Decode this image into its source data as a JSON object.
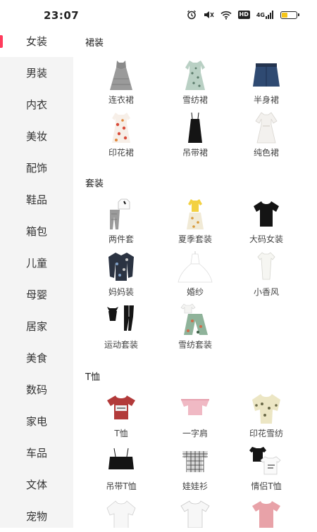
{
  "status_bar": {
    "time": "23:07",
    "network": "4G",
    "hd": "HD",
    "battery_level": 0.4
  },
  "sidebar": {
    "items": [
      {
        "label": "女装",
        "active": true
      },
      {
        "label": "男装"
      },
      {
        "label": "内衣"
      },
      {
        "label": "美妆"
      },
      {
        "label": "配饰"
      },
      {
        "label": "鞋品"
      },
      {
        "label": "箱包"
      },
      {
        "label": "儿童"
      },
      {
        "label": "母婴"
      },
      {
        "label": "居家"
      },
      {
        "label": "美食"
      },
      {
        "label": "数码"
      },
      {
        "label": "家电"
      },
      {
        "label": "车品"
      },
      {
        "label": "文体"
      },
      {
        "label": "宠物"
      }
    ]
  },
  "sections": [
    {
      "title": "裙装",
      "items": [
        {
          "label": "连衣裙",
          "icon": "gray-dress-icon"
        },
        {
          "label": "雪纺裙",
          "icon": "floral-chiffon-dress-icon"
        },
        {
          "label": "半身裙",
          "icon": "denim-skirt-icon"
        },
        {
          "label": "印花裙",
          "icon": "print-dress-icon"
        },
        {
          "label": "吊带裙",
          "icon": "slip-dress-icon"
        },
        {
          "label": "纯色裙",
          "icon": "white-dress-icon"
        }
      ]
    },
    {
      "title": "套装",
      "items": [
        {
          "label": "两件套",
          "icon": "two-piece-set-icon"
        },
        {
          "label": "夏季套装",
          "icon": "summer-set-icon"
        },
        {
          "label": "大码女装",
          "icon": "black-tshirt-icon"
        },
        {
          "label": "妈妈装",
          "icon": "printed-jacket-icon"
        },
        {
          "label": "婚纱",
          "icon": "wedding-dress-icon"
        },
        {
          "label": "小香风",
          "icon": "white-top-icon"
        },
        {
          "label": "运动套装",
          "icon": "sport-set-icon"
        },
        {
          "label": "雪纺套装",
          "icon": "chiffon-set-icon"
        }
      ]
    },
    {
      "title": "T恤",
      "items": [
        {
          "label": "T恤",
          "icon": "red-tshirt-icon"
        },
        {
          "label": "一字肩",
          "icon": "off-shoulder-top-icon"
        },
        {
          "label": "印花雪纺",
          "icon": "floral-blouse-icon"
        },
        {
          "label": "吊带T恤",
          "icon": "black-crop-top-icon"
        },
        {
          "label": "娃娃衫",
          "icon": "plaid-doll-top-icon"
        },
        {
          "label": "情侣T恤",
          "icon": "couple-tshirt-icon"
        },
        {
          "label": "",
          "icon": "white-blouse-icon"
        },
        {
          "label": "",
          "icon": "white-tshirt-icon"
        },
        {
          "label": "",
          "icon": "pink-tshirt-icon"
        }
      ]
    }
  ]
}
